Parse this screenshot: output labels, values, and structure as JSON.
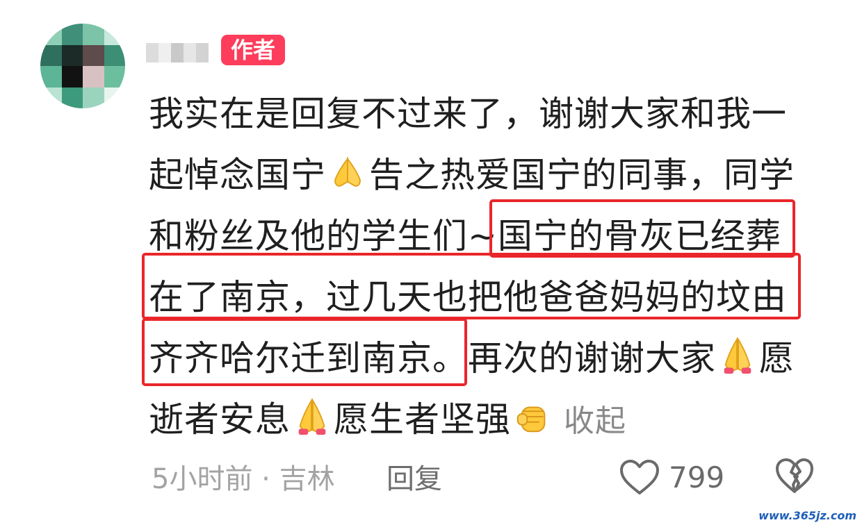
{
  "comment": {
    "author_badge": "作者",
    "lines": [
      "我实在是回复不过来了，谢谢大家和我一",
      "起悼念国宁",
      "告之热爱国宁的同事，同学",
      "和粉丝及他的学生们~国宁的骨灰已经葬",
      "在了南京，过几天也把他爸爸妈妈的坟由",
      "齐齐哈尔迁到南京。再次的谢谢大家",
      "愿",
      "逝者安息",
      "愿生者坚强"
    ],
    "collapse_label": "收起",
    "emojis": [
      "folded-hands",
      "folded-hands",
      "folded-hands",
      "raised-fist"
    ]
  },
  "meta": {
    "time_location": "5小时前 · 吉林",
    "reply_label": "回复",
    "like_count": "799"
  },
  "watermark": "www.365jz.com",
  "colors": {
    "badge": "#fd3d5b",
    "highlight_box": "#e9262b",
    "meta_text": "#a3a3a3"
  }
}
